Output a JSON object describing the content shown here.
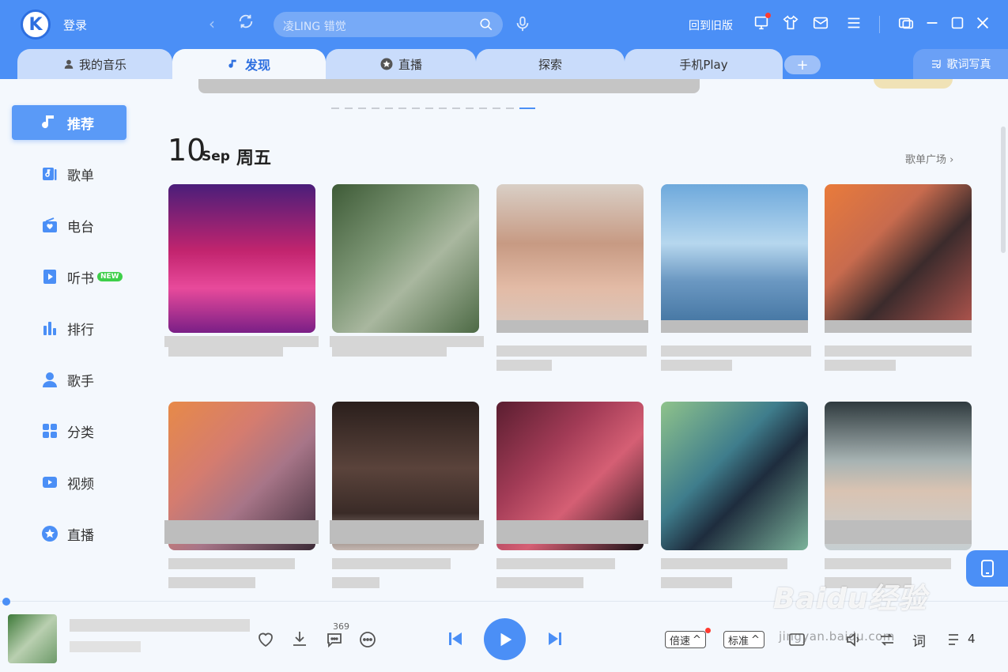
{
  "header": {
    "logo_letter": "K",
    "login_label": "登录",
    "search_placeholder": "凌LING 错觉",
    "old_version_label": "回到旧版"
  },
  "tabs": [
    {
      "label": "我的音乐",
      "active": false,
      "icon": "person-icon"
    },
    {
      "label": "发现",
      "active": true,
      "icon": "music-note-icon"
    },
    {
      "label": "直播",
      "active": false,
      "icon": "star-icon"
    },
    {
      "label": "探索",
      "active": false,
      "icon": ""
    },
    {
      "label": "手机Play",
      "active": false,
      "icon": ""
    }
  ],
  "tab_add_label": "+",
  "lyric_button_label": "歌词写真",
  "sidebar": {
    "items": [
      {
        "label": "推荐",
        "icon": "music-note-icon",
        "active": true
      },
      {
        "label": "歌单",
        "icon": "playlist-icon"
      },
      {
        "label": "电台",
        "icon": "radio-icon"
      },
      {
        "label": "听书",
        "icon": "book-play-icon",
        "badge": "NEW"
      },
      {
        "label": "排行",
        "icon": "bar-chart-icon"
      },
      {
        "label": "歌手",
        "icon": "singer-icon"
      },
      {
        "label": "分类",
        "icon": "category-icon"
      },
      {
        "label": "视频",
        "icon": "video-icon"
      },
      {
        "label": "直播",
        "icon": "live-star-icon"
      }
    ]
  },
  "main": {
    "date_day": "10",
    "date_month": "Sep",
    "date_weekday": "周五",
    "plaza_link": "歌单广场 ›",
    "carousel_dots": 15,
    "carousel_active_index": 14
  },
  "player": {
    "comment_count": "369",
    "speed_label": "倍速",
    "quality_label": "标准",
    "lyrics_label": "词",
    "queue_count": "4"
  },
  "watermark": {
    "brand": "Baidu经验",
    "url": "jingyan.baidu.com"
  },
  "colors": {
    "accent": "#4b8ff6",
    "header_bg": "#4b8ff6",
    "new_badge": "#3ecf4a"
  }
}
